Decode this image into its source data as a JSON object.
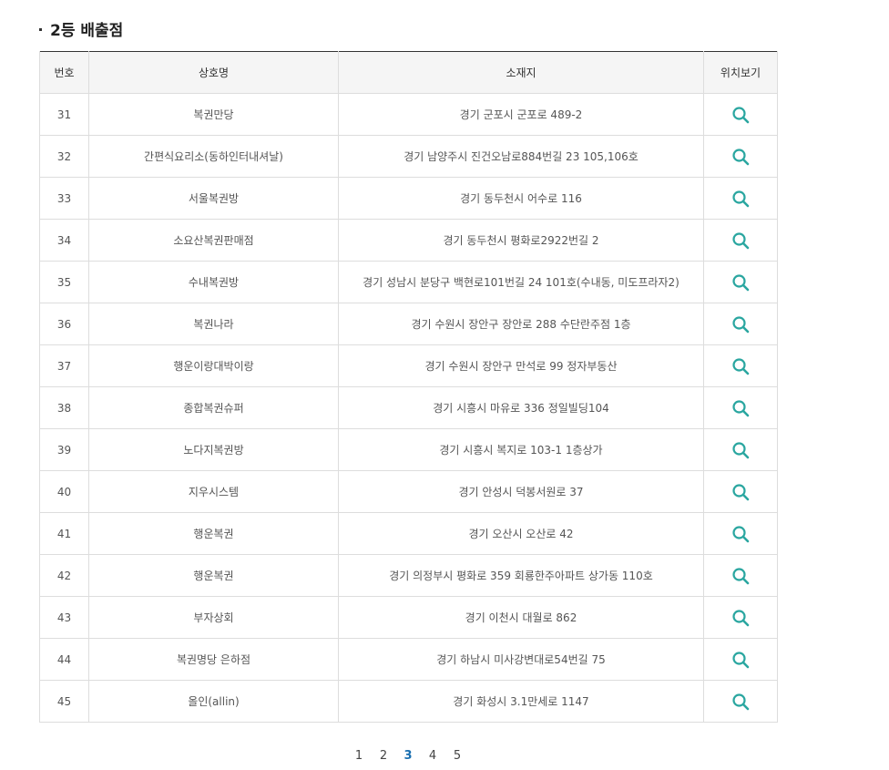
{
  "section": {
    "title": "2등 배출점"
  },
  "table": {
    "headers": {
      "no": "번호",
      "name": "상호명",
      "address": "소재지",
      "map": "위치보기"
    },
    "rows": [
      {
        "no": "31",
        "name": "복권만당",
        "address": "경기 군포시 군포로 489-2"
      },
      {
        "no": "32",
        "name": "간편식요리소(동하인터내셔날)",
        "address": "경기 남양주시 진건오남로884번길 23 105,106호"
      },
      {
        "no": "33",
        "name": "서울복권방",
        "address": "경기 동두천시 어수로 116"
      },
      {
        "no": "34",
        "name": "소요산복권판매점",
        "address": "경기 동두천시 평화로2922번길 2"
      },
      {
        "no": "35",
        "name": "수내복권방",
        "address": "경기 성남시 분당구 백현로101번길 24 101호(수내동, 미도프라자2)"
      },
      {
        "no": "36",
        "name": "복권나라",
        "address": "경기 수원시 장안구 장안로 288 수단란주점 1층"
      },
      {
        "no": "37",
        "name": "행운이랑대박이랑",
        "address": "경기 수원시 장안구 만석로 99 정자부동산"
      },
      {
        "no": "38",
        "name": "종합복권슈퍼",
        "address": "경기 시흥시 마유로 336 정일빌딩104"
      },
      {
        "no": "39",
        "name": "노다지복권방",
        "address": "경기 시흥시 복지로 103-1 1층상가"
      },
      {
        "no": "40",
        "name": "지우시스템",
        "address": "경기 안성시 덕봉서원로 37"
      },
      {
        "no": "41",
        "name": "행운복권",
        "address": "경기 오산시 오산로 42"
      },
      {
        "no": "42",
        "name": "행운복권",
        "address": "경기 의정부시 평화로 359 회룡한주아파트 상가동 110호"
      },
      {
        "no": "43",
        "name": "부자상회",
        "address": "경기 이천시 대월로 862"
      },
      {
        "no": "44",
        "name": "복권명당 은하점",
        "address": "경기 하남시 미사강변대로54번길 75"
      },
      {
        "no": "45",
        "name": "올인(allin)",
        "address": "경기 화성시 3.1만세로 1147"
      }
    ]
  },
  "pagination": {
    "pages": [
      "1",
      "2",
      "3",
      "4",
      "5"
    ],
    "current": "3"
  },
  "colors": {
    "icon": "#2aa6a0",
    "active_page": "#1a6fb0",
    "header_bg": "#f5f5f5",
    "border": "#dddddd"
  },
  "icons": {
    "map": "search-icon"
  }
}
